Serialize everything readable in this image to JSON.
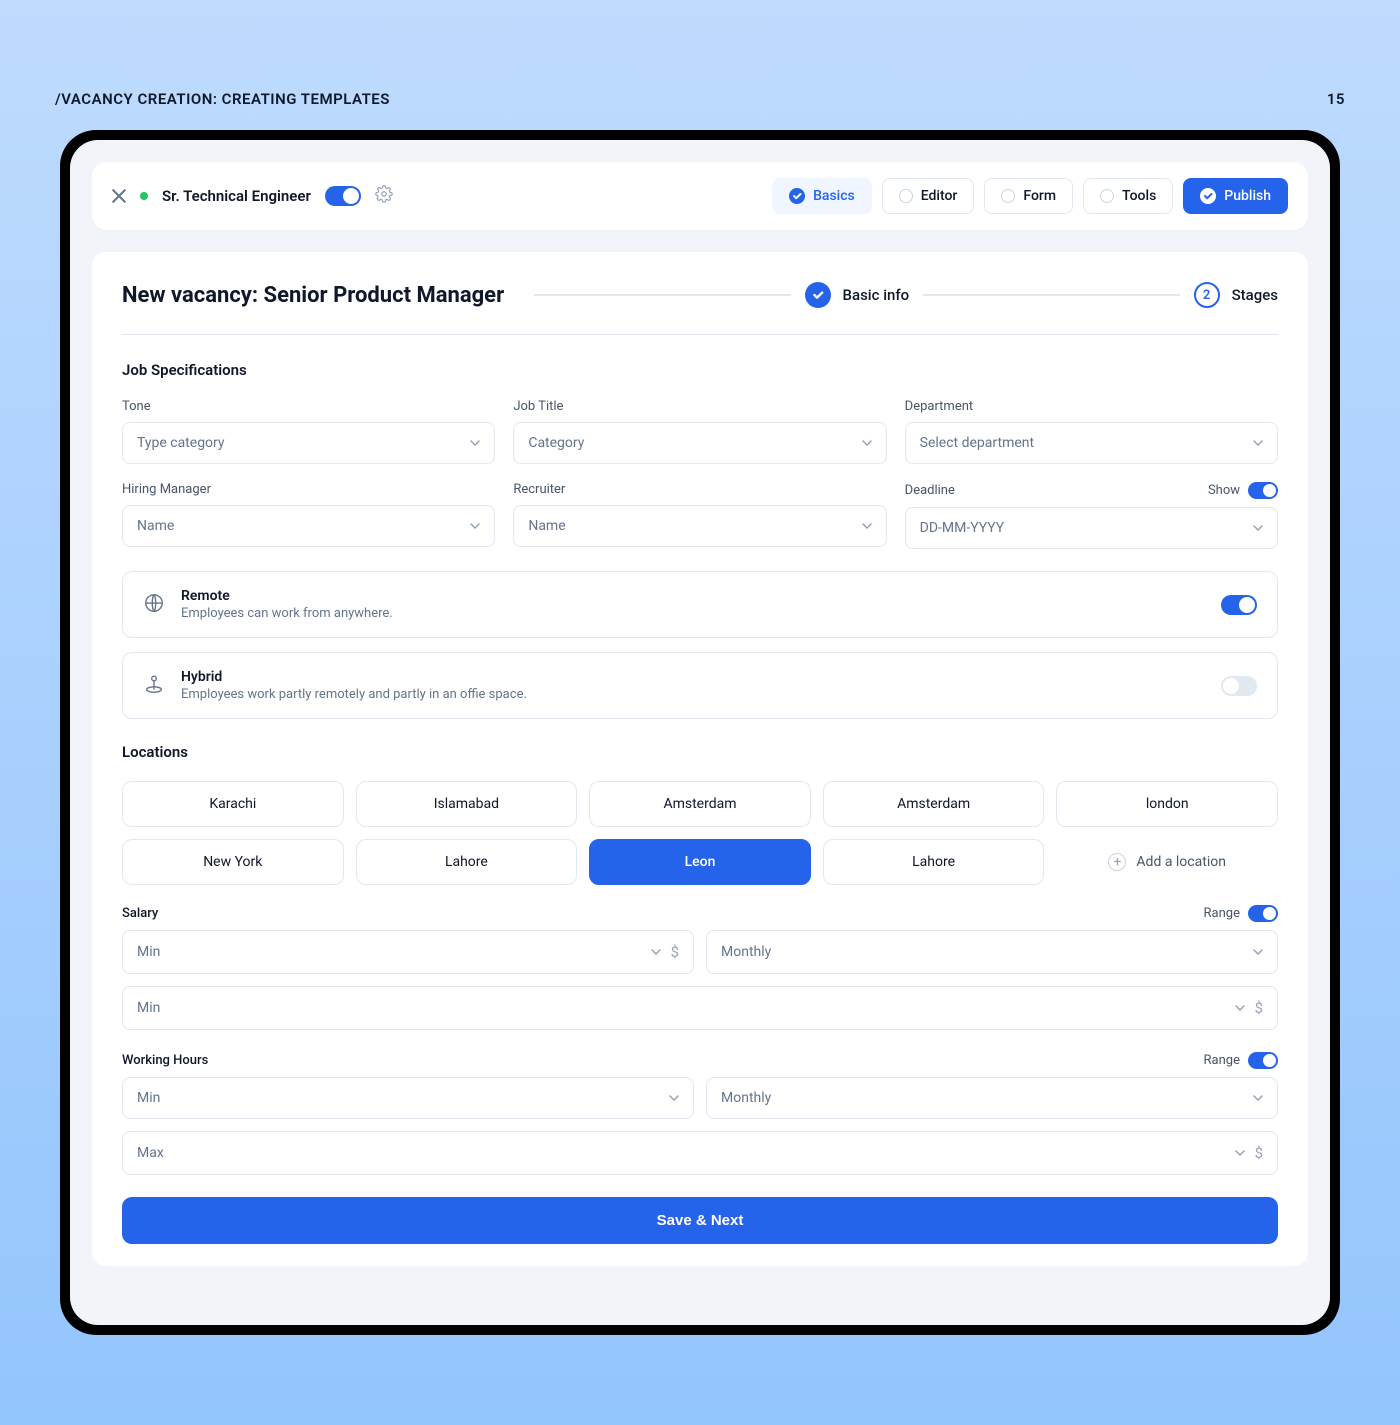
{
  "page_header": {
    "breadcrumb": "/VACANCY CREATION: CREATING TEMPLATES",
    "page_number": "15"
  },
  "toolbar": {
    "vacancy_title": "Sr. Technical Engineer",
    "tabs": {
      "basics": "Basics",
      "editor": "Editor",
      "form": "Form",
      "tools": "Tools",
      "publish": "Publish"
    }
  },
  "main": {
    "title": "New vacancy: Senior Product Manager",
    "steps": {
      "step1": "Basic info",
      "step2_num": "2",
      "step2": "Stages"
    },
    "job_spec_heading": "Job Specifications",
    "fields": {
      "tone": {
        "label": "Tone",
        "placeholder": "Type category"
      },
      "job_title": {
        "label": "Job Title",
        "placeholder": "Category"
      },
      "department": {
        "label": "Department",
        "placeholder": "Select department"
      },
      "hiring_manager": {
        "label": "Hiring Manager",
        "placeholder": "Name"
      },
      "recruiter": {
        "label": "Recruiter",
        "placeholder": "Name"
      },
      "deadline": {
        "label": "Deadline",
        "show_label": "Show",
        "placeholder": "DD-MM-YYYY"
      }
    },
    "remote": {
      "title": "Remote",
      "desc": "Employees can work from anywhere."
    },
    "hybrid": {
      "title": "Hybrid",
      "desc": "Employees work partly remotely and partly in an offie space."
    },
    "locations_heading": "Locations",
    "locations": [
      "Karachi",
      "Islamabad",
      "Amsterdam",
      "Amsterdam",
      "london",
      "New York",
      "Lahore",
      "Leon",
      "Lahore"
    ],
    "locations_selected_index": 7,
    "add_location": "Add a location",
    "salary": {
      "label": "Salary",
      "range_label": "Range",
      "min_ph": "Min",
      "freq_ph": "Monthly",
      "row2_ph": "Min"
    },
    "hours": {
      "label": "Working Hours",
      "range_label": "Range",
      "min_ph": "Min",
      "freq_ph": "Monthly",
      "row2_ph": "Max"
    },
    "save_btn": "Save & Next"
  }
}
